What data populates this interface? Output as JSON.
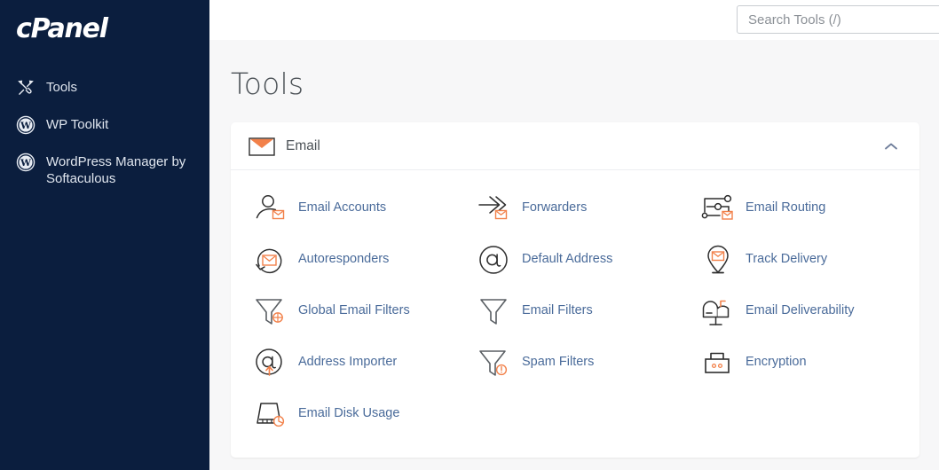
{
  "sidebar": {
    "logo": "cPanel",
    "items": [
      {
        "label": "Tools",
        "icon": "tools-icon"
      },
      {
        "label": "WP Toolkit",
        "icon": "wordpress-icon"
      },
      {
        "label": "WordPress Manager by Softaculous",
        "icon": "wordpress-icon"
      }
    ]
  },
  "topbar": {
    "search_placeholder": "Search Tools (/)"
  },
  "page": {
    "title": "Tools"
  },
  "section": {
    "title": "Email",
    "icon": "envelope-icon",
    "collapse_icon": "chevron-up-icon",
    "expanded": true,
    "tools": [
      {
        "label": "Email Accounts",
        "icon": "user-envelope-icon"
      },
      {
        "label": "Forwarders",
        "icon": "arrow-envelope-icon"
      },
      {
        "label": "Email Routing",
        "icon": "routing-envelope-icon"
      },
      {
        "label": "Autoresponders",
        "icon": "loop-envelope-icon"
      },
      {
        "label": "Default Address",
        "icon": "at-sign-icon"
      },
      {
        "label": "Track Delivery",
        "icon": "pin-envelope-icon"
      },
      {
        "label": "Global Email Filters",
        "icon": "funnel-globe-icon"
      },
      {
        "label": "Email Filters",
        "icon": "funnel-icon"
      },
      {
        "label": "Email Deliverability",
        "icon": "mailbox-icon"
      },
      {
        "label": "Address Importer",
        "icon": "at-sign-upload-icon"
      },
      {
        "label": "Spam Filters",
        "icon": "funnel-alert-icon"
      },
      {
        "label": "Encryption",
        "icon": "padlock-icon"
      },
      {
        "label": "Email Disk Usage",
        "icon": "disk-usage-icon"
      }
    ]
  },
  "colors": {
    "sidebar_bg": "#0b1e3e",
    "accent_orange": "#f2814a",
    "link_blue": "#4a6b9a",
    "page_bg": "#f7f7f8"
  }
}
